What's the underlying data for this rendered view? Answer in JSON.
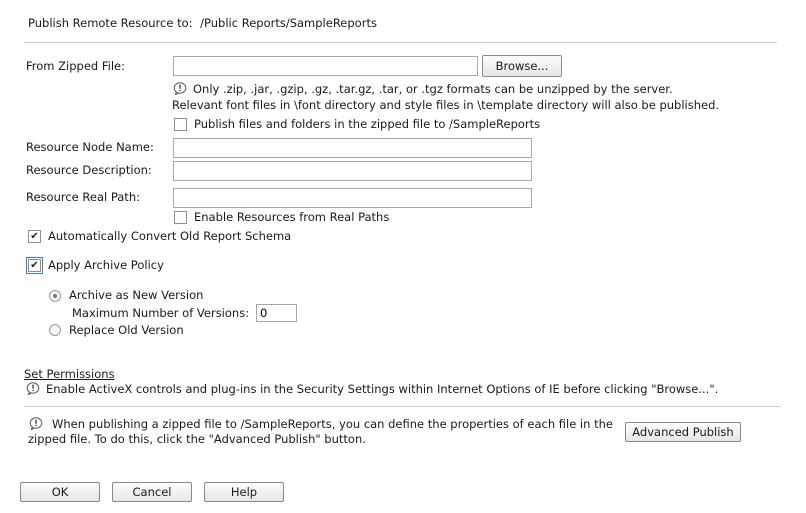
{
  "header": {
    "label": "Publish Remote Resource to:",
    "path": "/Public Reports/SampleReports"
  },
  "zipped_file": {
    "label": "From Zipped File:",
    "value": "",
    "browse_label": "Browse...",
    "note_line1": "Only .zip, .jar, .gzip, .gz, .tar.gz, .tar, or .tgz formats can be unzipped by the server.",
    "note_line2": "Relevant font files in \\font directory and style files in \\template directory will also be published.",
    "publish_folder_label": "Publish files and folders in the zipped file to /SampleReports",
    "publish_folder_checked": false
  },
  "resource": {
    "node_name_label": "Resource Node Name:",
    "node_name_value": "",
    "description_label": "Resource Description:",
    "description_value": "",
    "real_path_label": "Resource Real Path:",
    "real_path_value": "",
    "enable_real_paths_label": "Enable Resources from Real Paths",
    "enable_real_paths_checked": false
  },
  "options": {
    "convert_schema_label": "Automatically Convert Old Report Schema",
    "convert_schema_checked": true,
    "archive_policy_label": "Apply Archive Policy",
    "archive_policy_checked": true
  },
  "archive": {
    "new_version_label": "Archive as New Version",
    "max_versions_label": "Maximum Number of Versions:",
    "max_versions_value": "0",
    "replace_label": "Replace Old Version",
    "selected": "new_version"
  },
  "permissions": {
    "link_label": "Set Permissions",
    "activex_note": "Enable ActiveX controls and plug-ins in the Security Settings within Internet Options of IE before clicking \"Browse...\"."
  },
  "advanced": {
    "note_line1": "When publishing a zipped file to /SampleReports, you can define the properties of each file in the",
    "note_line2": "zipped file. To do this, click the \"Advanced Publish\" button.",
    "button_label": "Advanced Publish"
  },
  "footer": {
    "ok_label": "OK",
    "cancel_label": "Cancel",
    "help_label": "Help"
  }
}
